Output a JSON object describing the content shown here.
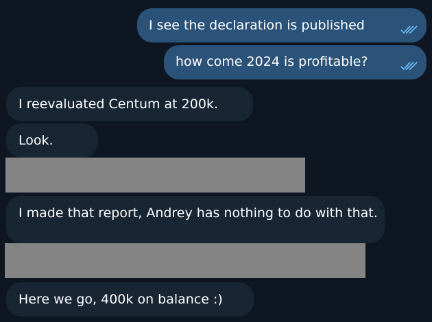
{
  "theme": {
    "background": "#0e1621",
    "outgoing_bubble": "#2b5278",
    "incoming_bubble": "#182533",
    "redaction": "#848484",
    "read_check": "#6bb8f2"
  },
  "messages": [
    {
      "direction": "outgoing",
      "text": "I see the declaration is published",
      "status_icon": "double-check-icon"
    },
    {
      "direction": "outgoing",
      "text": "how come 2024 is profitable?",
      "status_icon": "double-check-icon"
    },
    {
      "direction": "incoming",
      "text": "I reevaluated Centum at 200k."
    },
    {
      "direction": "incoming",
      "text": "Look."
    },
    {
      "direction": "incoming",
      "text": "I made that report, Andrey has nothing to do with that."
    },
    {
      "direction": "incoming",
      "text": "Here we go, 400k on balance :)"
    }
  ]
}
